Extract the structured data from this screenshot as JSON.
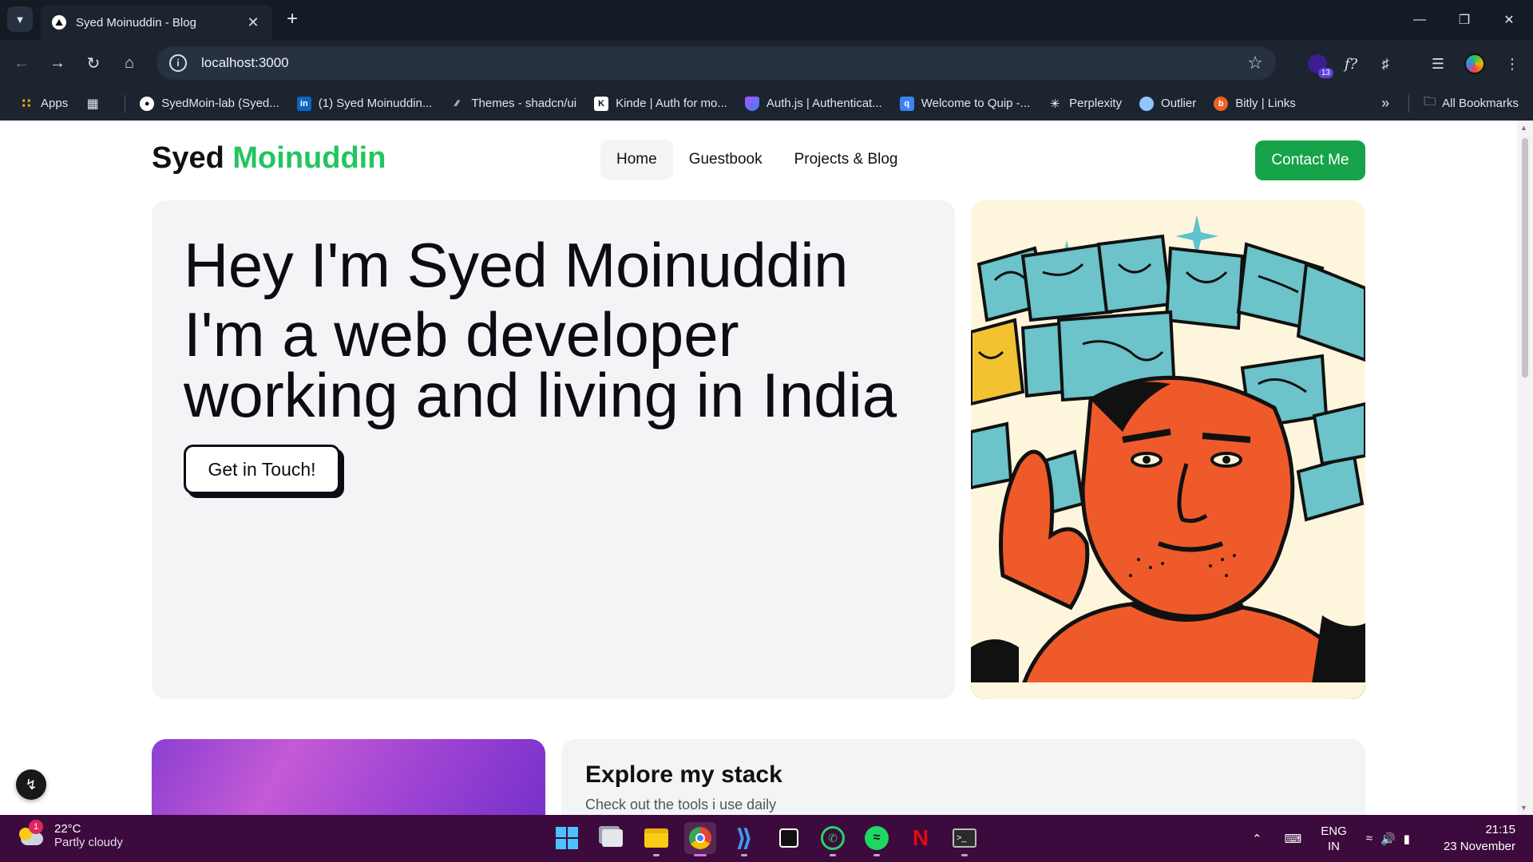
{
  "browser": {
    "tab_title": "Syed Moinuddin - Blog",
    "url": "localhost:3000",
    "extension_badge": "13",
    "bookmarks": [
      {
        "label": "Apps",
        "icon": "apps-grid-icon",
        "color": "#f4b400"
      },
      {
        "label": "SyedMoin-lab (Syed...",
        "icon": "github-icon",
        "color": "#ffffff"
      },
      {
        "label": "(1) Syed Moinuddin...",
        "icon": "linkedin-icon",
        "color": "#0a66c2"
      },
      {
        "label": "Themes - shadcn/ui",
        "icon": "shadcn-icon",
        "color": "#ffffff"
      },
      {
        "label": "Kinde | Auth for mo...",
        "icon": "kinde-icon",
        "color": "#ffffff"
      },
      {
        "label": "Auth.js | Authenticat...",
        "icon": "authjs-shield-icon",
        "color": "#a855f7"
      },
      {
        "label": "Welcome to Quip -...",
        "icon": "quip-icon",
        "color": "#3b82f6"
      },
      {
        "label": "Perplexity",
        "icon": "perplexity-icon",
        "color": "#ffffff"
      },
      {
        "label": "Outlier",
        "icon": "outlier-icon",
        "color": "#93c5fd"
      },
      {
        "label": "Bitly | Links",
        "icon": "bitly-icon",
        "color": "#ee6123"
      }
    ],
    "all_bookmarks": "All Bookmarks"
  },
  "site": {
    "brand_first": "Syed",
    "brand_second": "Moinuddin",
    "accent_color": "#22c55e",
    "nav": [
      "Home",
      "Guestbook",
      "Projects & Blog"
    ],
    "contact": "Contact Me",
    "hero": {
      "title": "Hey I'm Syed Moinuddin",
      "subtitle": "I'm a web developer working and living in India",
      "cta": "Get in Touch!"
    },
    "stack": {
      "title": "Explore my stack",
      "subtitle": "Check out the tools i use daily"
    }
  },
  "taskbar": {
    "temperature": "22°C",
    "condition": "Partly cloudy",
    "weather_badge": "1",
    "lang_top": "ENG",
    "lang_bottom": "IN",
    "time": "21:15",
    "date": "23 November"
  }
}
